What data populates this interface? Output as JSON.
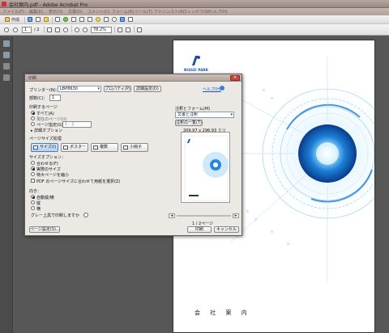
{
  "window": {
    "title": "会社案内.pdf - Adobe Acrobat Pro"
  },
  "menu": [
    "ファイル(F)",
    "編集(E)",
    "表示(V)",
    "文書(D)",
    "コメント(C)",
    "フォーム(R)",
    "ツール(T)",
    "アドバンスト(A)",
    "ウィンドウ(W)",
    "ヘルプ(H)"
  ],
  "toolbar": {
    "create_label": "作成",
    "page_current": "1",
    "page_total": "/ 2",
    "zoom": "78.2%"
  },
  "page": {
    "logo_text": "NISSEI PARK",
    "footer_text": "会 社 案 内"
  },
  "print_dialog": {
    "title": "印刷",
    "close": "✕",
    "printer_label": "プリンター(N)：",
    "printer_value": "LBP8630",
    "properties_btn": "プロパティ(P)",
    "advanced_btn": "詳細設定(D)",
    "help_link": "ヘルプ(H)",
    "copies_label": "部数(C)：",
    "copies_value": "1",
    "pages_section": "印刷するページ",
    "pages_all": "すべて(A)",
    "pages_current": "現在のページ(U)",
    "pages_range": "ページ指定(G)",
    "pages_range_value": "1 - 2",
    "more_options": "詳細オプション",
    "sizing_section": "ページサイズ処理",
    "size_btn": "サイズ(I)",
    "poster_btn": "ポスター",
    "multiple_btn": "複数",
    "booklet_btn": "小冊子",
    "size_options_label": "サイズオプション：",
    "fit": "合わせる(F)",
    "actual_size": "実際のサイズ",
    "shrink": "特大ページを縮小",
    "pdf_paper": "PDF のページサイズに合わせて用紙を選択(Z)",
    "orientation_label": "向き：",
    "auto_orient": "自動縦/横",
    "portrait": "縦",
    "landscape": "横",
    "grayscale_label": "グレー上黒で印刷しますか",
    "comments_label": "注釈とフォーム(M)",
    "comments_value": "文書と注釈",
    "summarize_btn": "注釈の一覧(T)",
    "paper_size": "209.97 x 296.93 ミリ",
    "page_indicator": "1 / 2ページ",
    "page_setup_btn": "ページ設定(S)...",
    "print_btn": "印刷",
    "cancel_btn": "キャンセル"
  },
  "colors": {
    "accent_blue": "#1a55c8",
    "page_blue": "#1a4ea0"
  }
}
